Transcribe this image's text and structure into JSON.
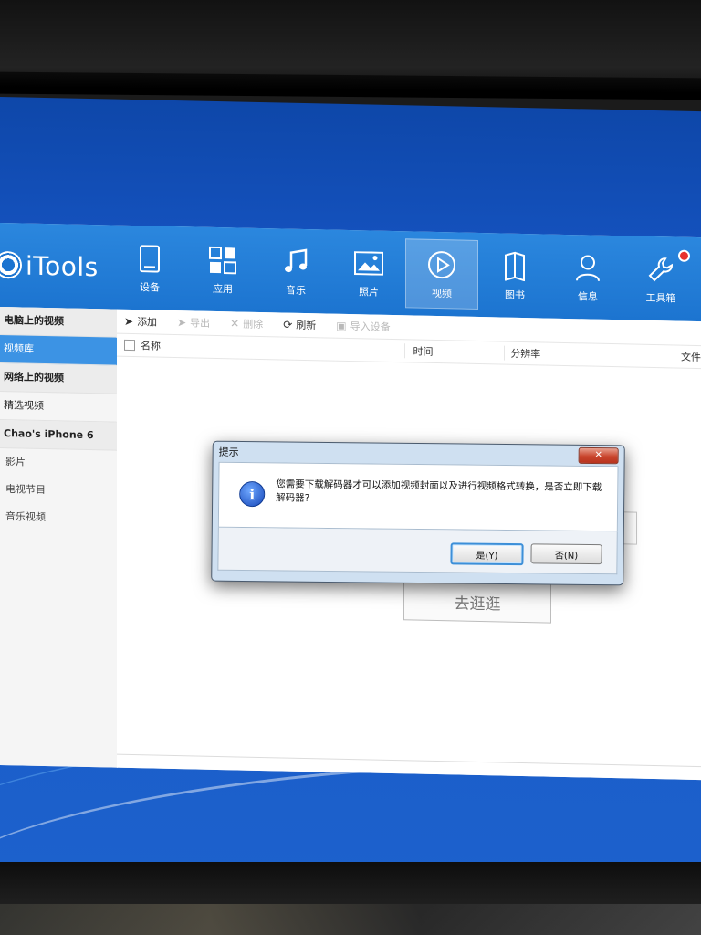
{
  "app": {
    "name": "iTools"
  },
  "nav": {
    "items": [
      {
        "label": "设备",
        "icon": "device-icon"
      },
      {
        "label": "应用",
        "icon": "apps-grid-icon"
      },
      {
        "label": "音乐",
        "icon": "music-note-icon"
      },
      {
        "label": "照片",
        "icon": "photo-icon"
      },
      {
        "label": "视频",
        "icon": "video-play-icon",
        "active": true
      },
      {
        "label": "图书",
        "icon": "book-icon"
      },
      {
        "label": "信息",
        "icon": "person-icon"
      },
      {
        "label": "工具箱",
        "icon": "wrench-icon",
        "badge": true
      }
    ]
  },
  "sidebar": {
    "computer_header": "电脑上的视频",
    "video_library": "视频库",
    "online_header": "网络上的视频",
    "featured_videos": "精选视频",
    "device_header": "Chao's iPhone 6",
    "movies": "影片",
    "tv_shows": "电视节目",
    "music_videos": "音乐视频"
  },
  "toolbar": {
    "add": "添加",
    "export": "导出",
    "delete": "删除",
    "refresh": "刷新",
    "import_device": "导入设备"
  },
  "table": {
    "columns": [
      "名称",
      "时间",
      "分辨率",
      "文件大小"
    ]
  },
  "main": {
    "go_browse": "去逛逛"
  },
  "dialog": {
    "title": "提示",
    "message": "您需要下载解码器才可以添加视频封面以及进行视频格式转换，是否立即下载解码器?",
    "yes": "是(Y)",
    "no": "否(N)",
    "close": "✕"
  },
  "colors": {
    "header_blue": "#1c74d0",
    "selected_blue": "#3c93e4",
    "desktop_blue": "#1553c0",
    "badge_red": "#e8322e"
  }
}
